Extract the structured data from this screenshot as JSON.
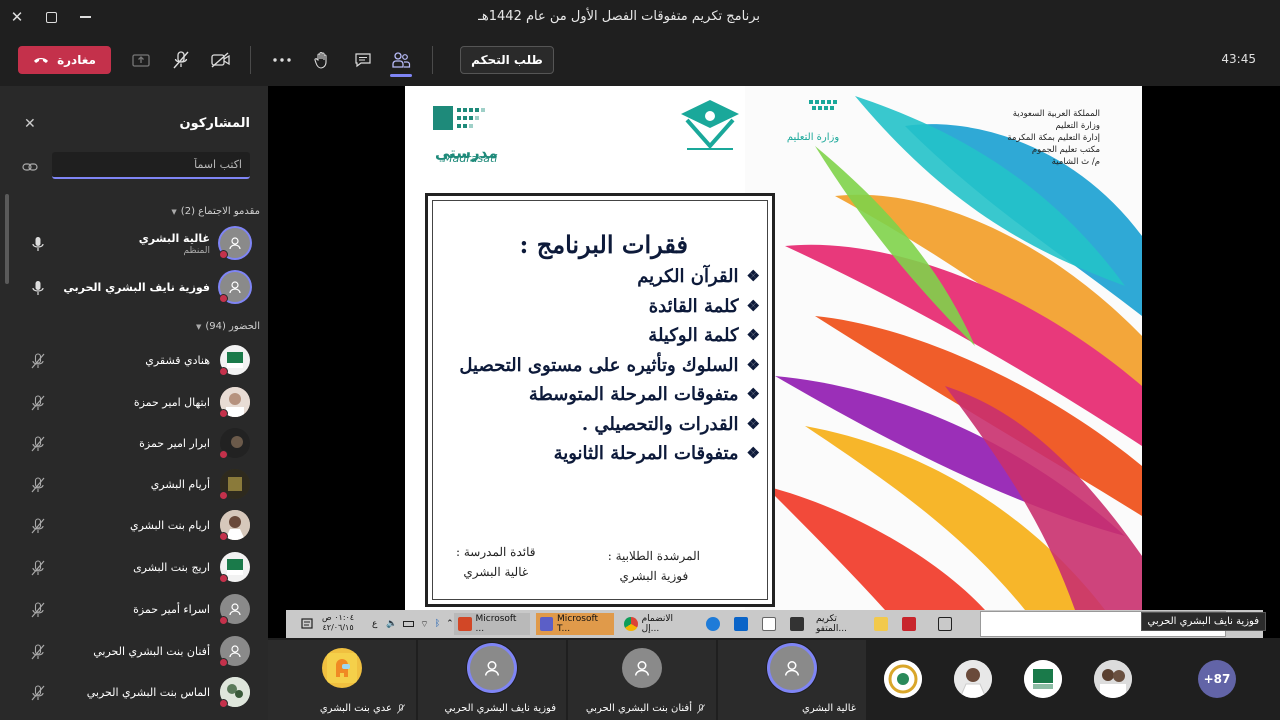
{
  "window": {
    "title": "برنامج تكريم متفوقات الفصل الأول من عام 1442هـ"
  },
  "toolbar": {
    "leave_label": "مغادرة",
    "request_control_label": "طلب التحكم",
    "timer": "43:45"
  },
  "participants_panel": {
    "title": "المشاركون",
    "search_placeholder": "اكتب اسماً",
    "presenters_header": "مقدمو الاجتماع (2)",
    "presenters": [
      {
        "name": "غالية البشري",
        "role": "المنظم"
      },
      {
        "name": "فوزية نايف البشري الحربي",
        "role": ""
      }
    ],
    "attendees_header": "الحضور (94)",
    "attendees": [
      {
        "name": "هنادي قشقري"
      },
      {
        "name": "ابتهال امير حمزة"
      },
      {
        "name": "ابرار امير حمزة"
      },
      {
        "name": "أريام البشري"
      },
      {
        "name": "اريام بنت البشري"
      },
      {
        "name": "اريج بنت البشرى"
      },
      {
        "name": "اسراء أمير حمزة"
      },
      {
        "name": "أفنان بنت البشري الحربي"
      },
      {
        "name": "الماس بنت البشري الحربي"
      }
    ]
  },
  "slide": {
    "header_lines": [
      "المملكة العربية السعودية",
      "وزارة التعليم",
      "إدارة التعليم بمكة المكرمة",
      "مكتب تعليم الجموم",
      "م/ ث الشامية"
    ],
    "moe_logo_text": "وزارة التعليم",
    "madrasati_ar": "مدرستي",
    "madrasati_en": "Madrasati",
    "program_title": "فقرات البرنامج :",
    "program_items": [
      "القرآن الكريم",
      "كلمة القائدة",
      "كلمة الوكيلة",
      "السلوك وتأثيره على مستوى التحصيل",
      "متفوقات المرحلة المتوسطة",
      "القدرات والتحصيلي .",
      "متفوقات المرحلة الثانوية"
    ],
    "bullet": "❖",
    "sig_left_title": "قائدة المدرسة :",
    "sig_left_name": "غالية البشري",
    "sig_right_title": "المرشدة الطلابية :",
    "sig_right_name": "فوزية البشري"
  },
  "taskbar": {
    "time": "٠١:٠٤ ص",
    "date": "٤٢/٠٦/١٥",
    "items": [
      "Microsoft ...",
      "Microsoft T...",
      "الانضمام إل...",
      "تكريم المتفو..."
    ],
    "tooltip": "فوزية نايف البشري الحربي"
  },
  "gallery": {
    "tiles": [
      {
        "name": "عدي بنت البشري"
      },
      {
        "name": "فوزية نايف البشري الحربي"
      },
      {
        "name": "أفنان بنت البشري الحربي"
      },
      {
        "name": "غالية البشري"
      }
    ],
    "more_count": "+87"
  },
  "colors": {
    "accent": "#7f85f5",
    "leave": "#c4314b",
    "panel": "#292929",
    "background": "#1f1f1f"
  }
}
